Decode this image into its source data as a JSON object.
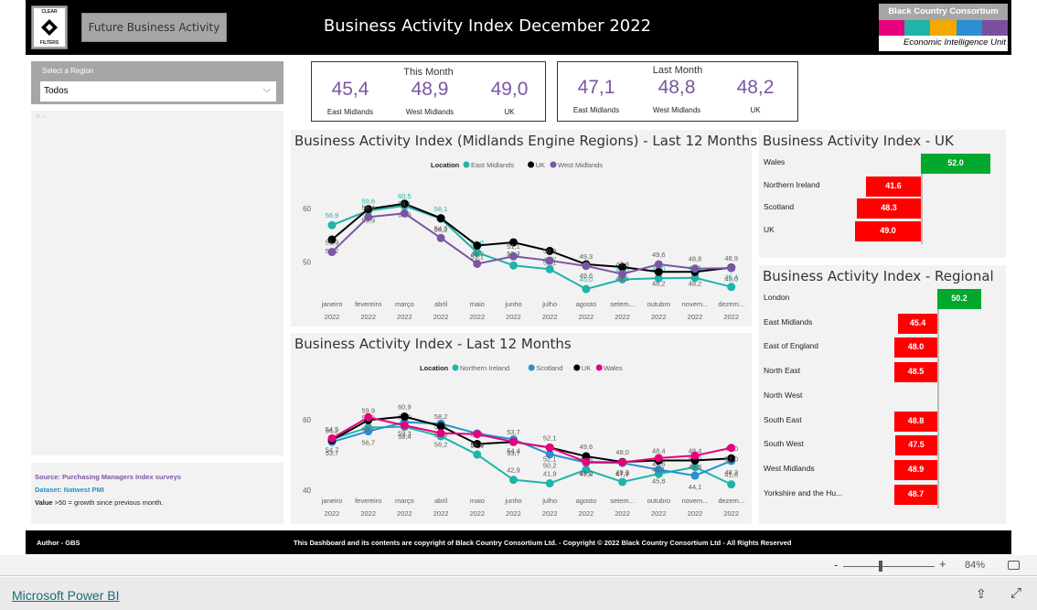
{
  "header": {
    "title": "Business Activity Index December 2022",
    "future_button": "Future Business Activity",
    "clear_filters_top": "CLEAR",
    "clear_filters_bottom": "FILTERS",
    "logo": {
      "name": "Black Country Consortium",
      "subtitle": "Economic Intelligence Unit",
      "stripe_colors": [
        "#e6007e",
        "#1fb3aa",
        "#f5a800",
        "#2b8fd1",
        "#7a4fa0"
      ]
    }
  },
  "slicer": {
    "label": "Select a Region",
    "value": "Todos"
  },
  "source": {
    "source": "Source: Purchasing Managers Index surveys",
    "dataset": "Dataset: Natwest PMI",
    "value_bold": "Value",
    "value_text": " >50 = growth since previous month."
  },
  "cards": [
    {
      "title": "This Month",
      "items": [
        {
          "value": "45,4",
          "label": "East Midlands"
        },
        {
          "value": "48,9",
          "label": "West Midlands"
        },
        {
          "value": "49,0",
          "label": "UK"
        }
      ]
    },
    {
      "title": "Last Month",
      "items": [
        {
          "value": "47,1",
          "label": "East Midlands"
        },
        {
          "value": "48,8",
          "label": "West Midlands"
        },
        {
          "value": "48,2",
          "label": "UK"
        }
      ]
    }
  ],
  "chart_data": [
    {
      "type": "line",
      "title": "Business Activity Index (Midlands Engine Regions) - Last 12 Months",
      "legend_title": "Location",
      "legend_position": "top",
      "categories": [
        [
          "janeiro",
          "2022"
        ],
        [
          "fevereiro",
          "2022"
        ],
        [
          "março",
          "2022"
        ],
        [
          "abril",
          "2022"
        ],
        [
          "maio",
          "2022"
        ],
        [
          "junho",
          "2022"
        ],
        [
          "julho",
          "2022"
        ],
        [
          "agosto",
          "2022"
        ],
        [
          "setem...",
          "2022"
        ],
        [
          "outubro",
          "2022"
        ],
        [
          "novem...",
          "2022"
        ],
        [
          "dezem...",
          "2022"
        ]
      ],
      "yticks": [
        "60",
        "50"
      ],
      "ylim": [
        44,
        62
      ],
      "series": [
        {
          "name": "East Midlands",
          "color": "#1fb3aa",
          "values": [
            56.9,
            59.6,
            60.5,
            58.1,
            51.8,
            49.4,
            48.7,
            45.0,
            46.8,
            47.0,
            47.1,
            45.4
          ]
        },
        {
          "name": "UK",
          "color": "#000000",
          "values": [
            54.2,
            59.9,
            60.9,
            58.2,
            53.1,
            53.7,
            52.1,
            49.6,
            49.1,
            48.2,
            48.2,
            49.0
          ]
        },
        {
          "name": "West Midlands",
          "color": "#7a56a3",
          "values": [
            51.9,
            58.4,
            59.1,
            54.5,
            49.7,
            51.1,
            50.3,
            49.3,
            47.8,
            49.6,
            48.8,
            48.9
          ]
        }
      ]
    },
    {
      "type": "line",
      "title": "Business Activity Index - Last 12 Months",
      "legend_title": "Location",
      "legend_position": "top",
      "categories": [
        [
          "janeiro",
          "2022"
        ],
        [
          "fevereiro",
          "2022"
        ],
        [
          "março",
          "2022"
        ],
        [
          "abril",
          "2022"
        ],
        [
          "maio",
          "2022"
        ],
        [
          "junho",
          "2022"
        ],
        [
          "julho",
          "2022"
        ],
        [
          "agosto",
          "2022"
        ],
        [
          "setem...",
          "2022"
        ],
        [
          "outubro",
          "2022"
        ],
        [
          "novem...",
          "2022"
        ],
        [
          "dezem...",
          "2022"
        ]
      ],
      "yticks": [
        "60",
        "40"
      ],
      "ylim": [
        38,
        64
      ],
      "series": [
        {
          "name": "Northern Ireland",
          "color": "#1fb3aa",
          "values": [
            54.5,
            57.8,
            58.0,
            55.3,
            50.1,
            42.9,
            41.9,
            45.8,
            42.3,
            44.6,
            46.5,
            41.6
          ]
        },
        {
          "name": "Scotland",
          "color": "#2b8fd1",
          "values": [
            53.7,
            56.7,
            59.3,
            58.9,
            56.1,
            54.4,
            50.2,
            47.8,
            47.7,
            45.8,
            44.1,
            48.3
          ]
        },
        {
          "name": "UK",
          "color": "#000000",
          "values": [
            54.2,
            59.9,
            60.9,
            58.2,
            53.1,
            53.7,
            52.1,
            49.6,
            48.0,
            48.4,
            48.4,
            49.0
          ]
        },
        {
          "name": "Wales",
          "color": "#e6007e",
          "values": [
            54.7,
            60.7,
            58.4,
            56.2,
            55.9,
            53.7,
            52.1,
            48.0,
            47.9,
            49.1,
            49.8,
            52.0
          ]
        }
      ]
    },
    {
      "type": "bar",
      "title": "Business Activity Index - UK",
      "baseline": 50,
      "categories": [
        "Wales",
        "Northern Ireland",
        "Scotland",
        "UK"
      ],
      "values": [
        52.0,
        41.6,
        48.3,
        49.0
      ],
      "labels": [
        "52.0",
        "41.6",
        "48.3",
        "49.0"
      ]
    },
    {
      "type": "bar",
      "title": "Business Activity Index - Regional",
      "baseline": 50,
      "categories": [
        "London",
        "East Midlands",
        "East of England",
        "North East",
        "North West",
        "South East",
        "South West",
        "West Midlands",
        "Yorkshire and the Hu..."
      ],
      "values": [
        50.2,
        45.4,
        48.0,
        48.5,
        null,
        48.8,
        47.5,
        48.9,
        48.7
      ],
      "labels": [
        "50.2",
        "45.4",
        "48.0",
        "48.5",
        "",
        "48.8",
        "47.5",
        "48.9",
        "48.7"
      ]
    }
  ],
  "colors": {
    "above": "#00a82d",
    "below": "#ff0000"
  },
  "footer": {
    "author": "Author - GBS",
    "copyright": "This Dashboard and its contents are copyright of Black Country Consortium Ltd.  -  Copyright © 2022 Black Country Consortium Ltd - All Rights Reserved"
  },
  "zoom": {
    "minus": "-",
    "plus": "+",
    "level": "84%",
    "level_percent": 84
  },
  "bottom": {
    "link": "Microsoft Power BI"
  }
}
